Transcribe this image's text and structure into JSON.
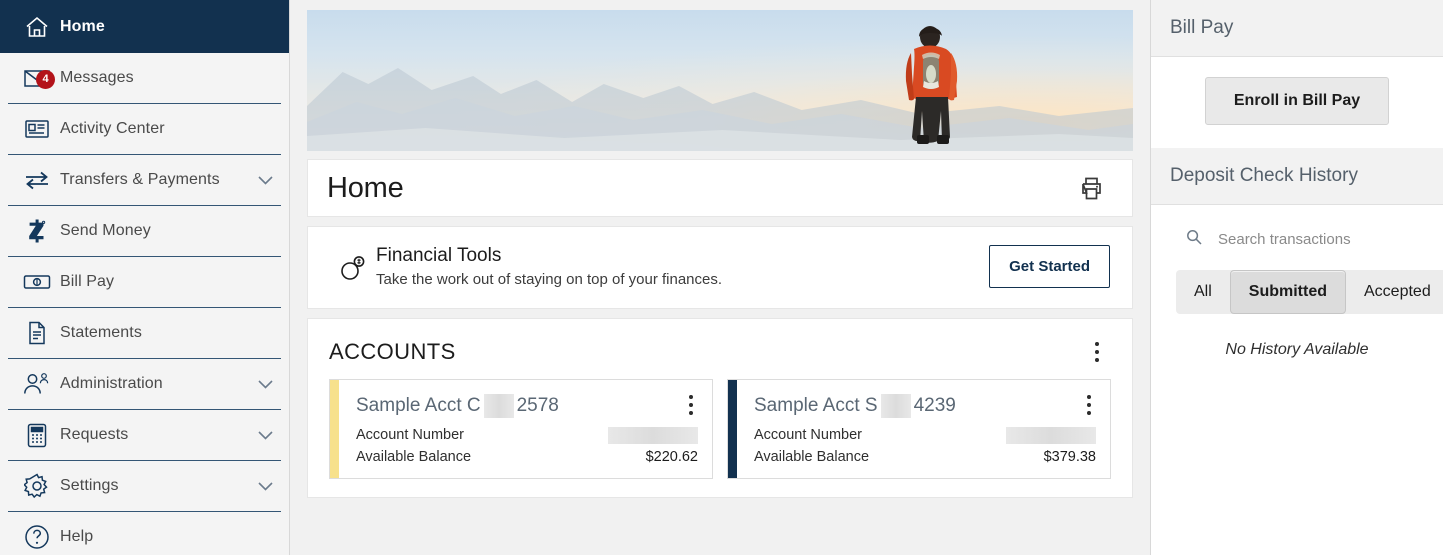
{
  "sidebar": {
    "items": [
      {
        "label": "Home",
        "icon": "home-icon",
        "active": true,
        "chevron": false,
        "badge": null
      },
      {
        "label": "Messages",
        "icon": "envelope-icon",
        "active": false,
        "chevron": false,
        "badge": "4"
      },
      {
        "label": "Activity Center",
        "icon": "newspaper-icon",
        "active": false,
        "chevron": false,
        "badge": null
      },
      {
        "label": "Transfers & Payments",
        "icon": "transfer-arrows-icon",
        "active": false,
        "chevron": true,
        "badge": null
      },
      {
        "label": "Send Money",
        "icon": "zelle-z-icon",
        "active": false,
        "chevron": false,
        "badge": null
      },
      {
        "label": "Bill Pay",
        "icon": "banknote-icon",
        "active": false,
        "chevron": false,
        "badge": null
      },
      {
        "label": "Statements",
        "icon": "document-icon",
        "active": false,
        "chevron": false,
        "badge": null
      },
      {
        "label": "Administration",
        "icon": "user-admin-icon",
        "active": false,
        "chevron": true,
        "badge": null
      },
      {
        "label": "Requests",
        "icon": "calculator-icon",
        "active": false,
        "chevron": true,
        "badge": null
      },
      {
        "label": "Settings",
        "icon": "gear-icon",
        "active": false,
        "chevron": true,
        "badge": null
      },
      {
        "label": "Help",
        "icon": "question-circle-icon",
        "active": false,
        "chevron": false,
        "badge": null
      }
    ]
  },
  "main": {
    "hero_alt": "hiker-with-backpack-on-mountain-ridge",
    "page_title": "Home",
    "print_icon": "printer-icon",
    "financial_tools": {
      "icon": "coins-icon",
      "title": "Financial Tools",
      "subtitle": "Take the work out of staying on top of your finances.",
      "cta_label": "Get Started"
    },
    "accounts": {
      "heading": "ACCOUNTS",
      "menu_icon": "kebab-menu-icon",
      "columns": {
        "account_number": "Account Number",
        "available_balance": "Available Balance"
      },
      "cards": [
        {
          "name_prefix": "Sample Acct C",
          "name_suffix": "2578",
          "accent_color": "#f7e18c",
          "account_number_masked": true,
          "available_balance": "$220.62",
          "menu_icon": "kebab-menu-icon"
        },
        {
          "name_prefix": "Sample Acct S",
          "name_suffix": "4239",
          "accent_color": "#12314f",
          "account_number_masked": true,
          "available_balance": "$379.38",
          "menu_icon": "kebab-menu-icon"
        }
      ]
    }
  },
  "rail": {
    "bill_pay": {
      "heading": "Bill Pay",
      "enroll_label": "Enroll in Bill Pay"
    },
    "deposit_check_history": {
      "heading": "Deposit Check History",
      "search_icon": "search-icon",
      "search_placeholder": "Search transactions",
      "search_value": "",
      "tabs": [
        {
          "label": "All",
          "active": false
        },
        {
          "label": "Submitted",
          "active": true
        },
        {
          "label": "Accepted",
          "active": false
        }
      ],
      "empty_message": "No History Available"
    }
  },
  "colors": {
    "nav_active_bg": "#12314f",
    "accent_navy": "#14385c",
    "badge_red": "#b3131a",
    "card_accent_yellow": "#f7e18c",
    "card_accent_navy": "#12314f"
  }
}
